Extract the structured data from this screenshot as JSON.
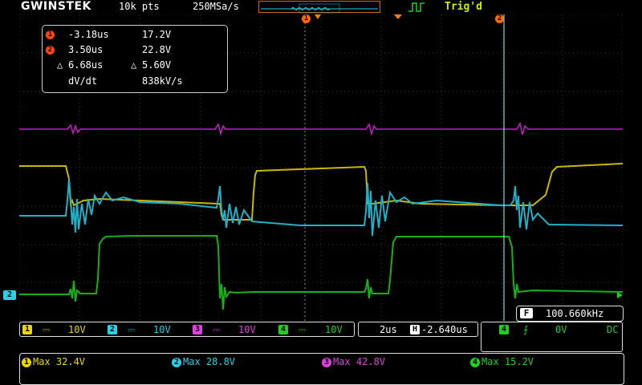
{
  "header": {
    "brand": "GWINSTEK",
    "record_length": "10k pts",
    "sample_rate": "250MSa/s",
    "trigger_status": "Trig'd"
  },
  "cursors": {
    "c1_time": "-3.18us",
    "c1_volt": "17.2V",
    "c2_time": "3.50us",
    "c2_volt": "22.8V",
    "delta_time": "6.68us",
    "delta_volt": "5.60V",
    "dvdt_label": "dV/dt",
    "dvdt_value": "838kV/s",
    "c1_badge": "1",
    "c2_badge": "2",
    "delta_symbol": "△"
  },
  "frequency": {
    "badge": "F",
    "value": "100.660kHz"
  },
  "channels": [
    {
      "num": "1",
      "coupling": "⎓",
      "scale": "10V",
      "color": "#e8d800"
    },
    {
      "num": "2",
      "coupling": "⎓",
      "scale": "10V",
      "color": "#28d0e8"
    },
    {
      "num": "3",
      "coupling": "⎓",
      "scale": "10V",
      "color": "#e040e0"
    },
    {
      "num": "4",
      "coupling": "⎓",
      "scale": "10V",
      "color": "#20d020"
    }
  ],
  "timebase": {
    "scale": "2us",
    "position_icon": "H",
    "position": "-2.640us"
  },
  "trigger": {
    "source": "4",
    "slope_symbol": "⨍",
    "level": "0V",
    "coupling": "DC"
  },
  "measurements": [
    {
      "num": "1",
      "text": "Max 32.4V",
      "color": "#e8d800"
    },
    {
      "num": "2",
      "text": "Max 28.8V",
      "color": "#28d0e8"
    },
    {
      "num": "3",
      "text": "Max 42.8V",
      "color": "#e040e0"
    },
    {
      "num": "4",
      "text": "Max 15.2V",
      "color": "#20d020"
    }
  ],
  "markers": {
    "ch2_ground": "2",
    "cursor1": "1",
    "cursor2": "2"
  }
}
